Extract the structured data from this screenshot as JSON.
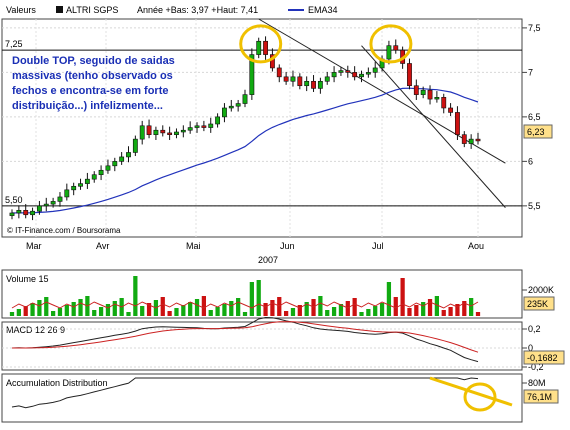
{
  "header": {
    "label": "Valeurs",
    "ticker": "ALTRI SGPS",
    "stats": "Année +Bas: 3,97 +Haut: 7,41",
    "ema_label": "EMA34"
  },
  "annotation": "Double TOP, seguido de saidas massivas (tenho observado os fechos e encontra-se em forte distribuição...) infelizmente...",
  "copyright": "© IT-Finance.com / Boursorama",
  "colors": {
    "up": "#11aa11",
    "down": "#cc1111",
    "ema": "#2233bb",
    "channel": "#222222",
    "highlight": "#f0c000",
    "last_badge": "#ffe08a"
  },
  "chart_data": [
    {
      "type": "candlestick",
      "title": "ALTRI SGPS",
      "x_labels": [
        "Mar",
        "Avr",
        "Mai",
        "Jun",
        "Jul",
        "Aou"
      ],
      "x_axis_year": "2007",
      "y_ticks": [
        "7,5",
        "7",
        "6,5",
        "6",
        "5,5"
      ],
      "ylim": [
        5.15,
        7.6
      ],
      "level_lines": [
        7.25,
        5.5
      ],
      "level_labels": [
        "7,25",
        "5,50"
      ],
      "last_value": "6,23",
      "ema_period": 34,
      "close": [
        5.42,
        5.45,
        5.4,
        5.44,
        5.5,
        5.52,
        5.55,
        5.6,
        5.68,
        5.72,
        5.75,
        5.8,
        5.85,
        5.9,
        5.95,
        6.0,
        6.05,
        6.1,
        6.25,
        6.4,
        6.3,
        6.35,
        6.32,
        6.3,
        6.33,
        6.35,
        6.38,
        6.4,
        6.38,
        6.42,
        6.5,
        6.6,
        6.62,
        6.65,
        6.75,
        7.2,
        7.35,
        7.2,
        7.05,
        6.95,
        6.9,
        6.95,
        6.85,
        6.9,
        6.82,
        6.9,
        6.95,
        7.0,
        7.02,
        7.0,
        6.95,
        6.98,
        7.0,
        7.05,
        7.15,
        7.3,
        7.25,
        7.1,
        6.85,
        6.75,
        6.8,
        6.7,
        6.72,
        6.6,
        6.55,
        6.3,
        6.2,
        6.25,
        6.23
      ]
    },
    {
      "type": "bar",
      "title": "Volume 15",
      "y_ticks": [
        "2000K"
      ],
      "last_value": "235K"
    },
    {
      "type": "line",
      "title": "MACD 12 26 9",
      "y_ticks": [
        "0,2",
        "0",
        "-0,2"
      ],
      "last_value": "-0,1682"
    },
    {
      "type": "line",
      "title": "Accumulation Distribution",
      "y_ticks": [
        "80M"
      ],
      "last_value": "76,1M"
    }
  ]
}
